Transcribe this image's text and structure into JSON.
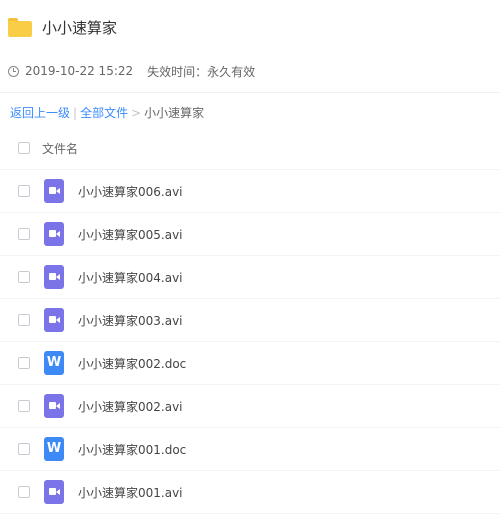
{
  "header": {
    "title": "小小速算家"
  },
  "meta": {
    "datetime": "2019-10-22 15:22",
    "expiry": "失效时间：永久有效"
  },
  "breadcrumb": {
    "back": "返回上一级",
    "divider": "|",
    "all_files": "全部文件",
    "arrow": ">",
    "current": "小小速算家"
  },
  "list_header": {
    "label": "文件名"
  },
  "files": [
    {
      "name": "小小速算家006.avi",
      "type": "video"
    },
    {
      "name": "小小速算家005.avi",
      "type": "video"
    },
    {
      "name": "小小速算家004.avi",
      "type": "video"
    },
    {
      "name": "小小速算家003.avi",
      "type": "video"
    },
    {
      "name": "小小速算家002.doc",
      "type": "word",
      "icon_letter": "W"
    },
    {
      "name": "小小速算家002.avi",
      "type": "video"
    },
    {
      "name": "小小速算家001.doc",
      "type": "word",
      "icon_letter": "W"
    },
    {
      "name": "小小速算家001.avi",
      "type": "video"
    }
  ],
  "colors": {
    "link": "#3b8cff",
    "video_icon": "#7b73e8",
    "word_icon": "#3d8af7",
    "folder": "#f9cd45"
  }
}
